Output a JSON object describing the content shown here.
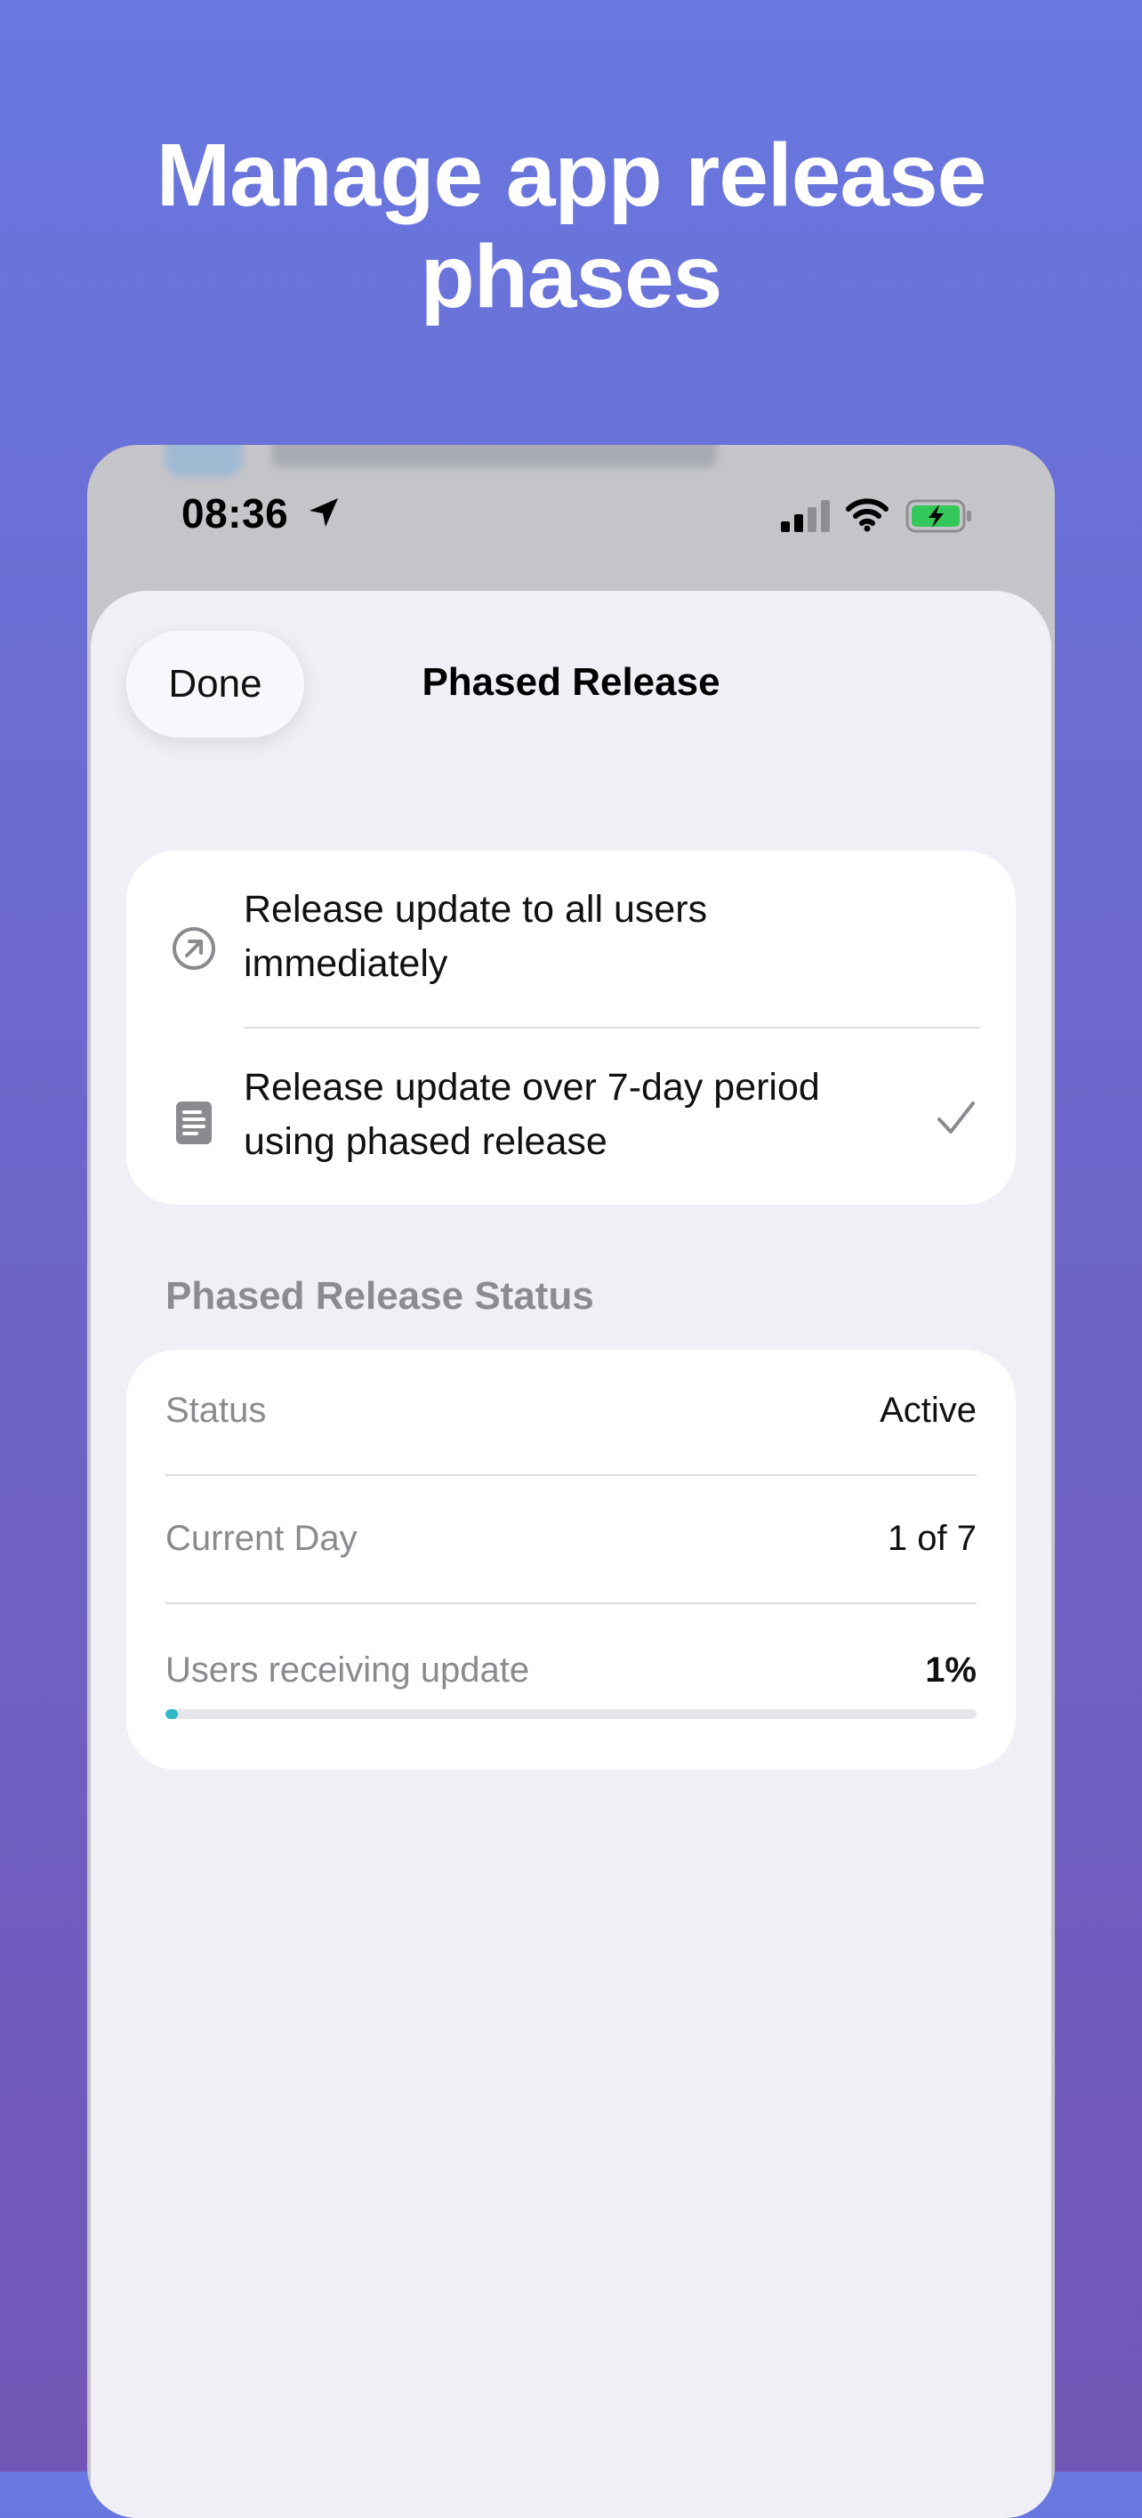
{
  "hero": {
    "title_line1": "Manage app release",
    "title_line2": "phases"
  },
  "status_bar": {
    "time": "08:36"
  },
  "sheet": {
    "done_label": "Done",
    "title": "Phased Release",
    "options": [
      {
        "icon": "arrow-up-right-circle-icon",
        "label_line1": "Release update to all users",
        "label_line2": "immediately",
        "selected": false
      },
      {
        "icon": "document-icon",
        "label_line1": "Release update over 7-day period",
        "label_line2": "using phased release",
        "selected": true
      }
    ],
    "status_section": {
      "header": "Phased Release Status",
      "rows": [
        {
          "label": "Status",
          "value": "Active"
        },
        {
          "label": "Current Day",
          "value": "1 of 7"
        },
        {
          "label": "Users receiving update",
          "value": "1%"
        }
      ],
      "progress_fraction": 0.015,
      "progress_color": "#30b8c8"
    }
  }
}
